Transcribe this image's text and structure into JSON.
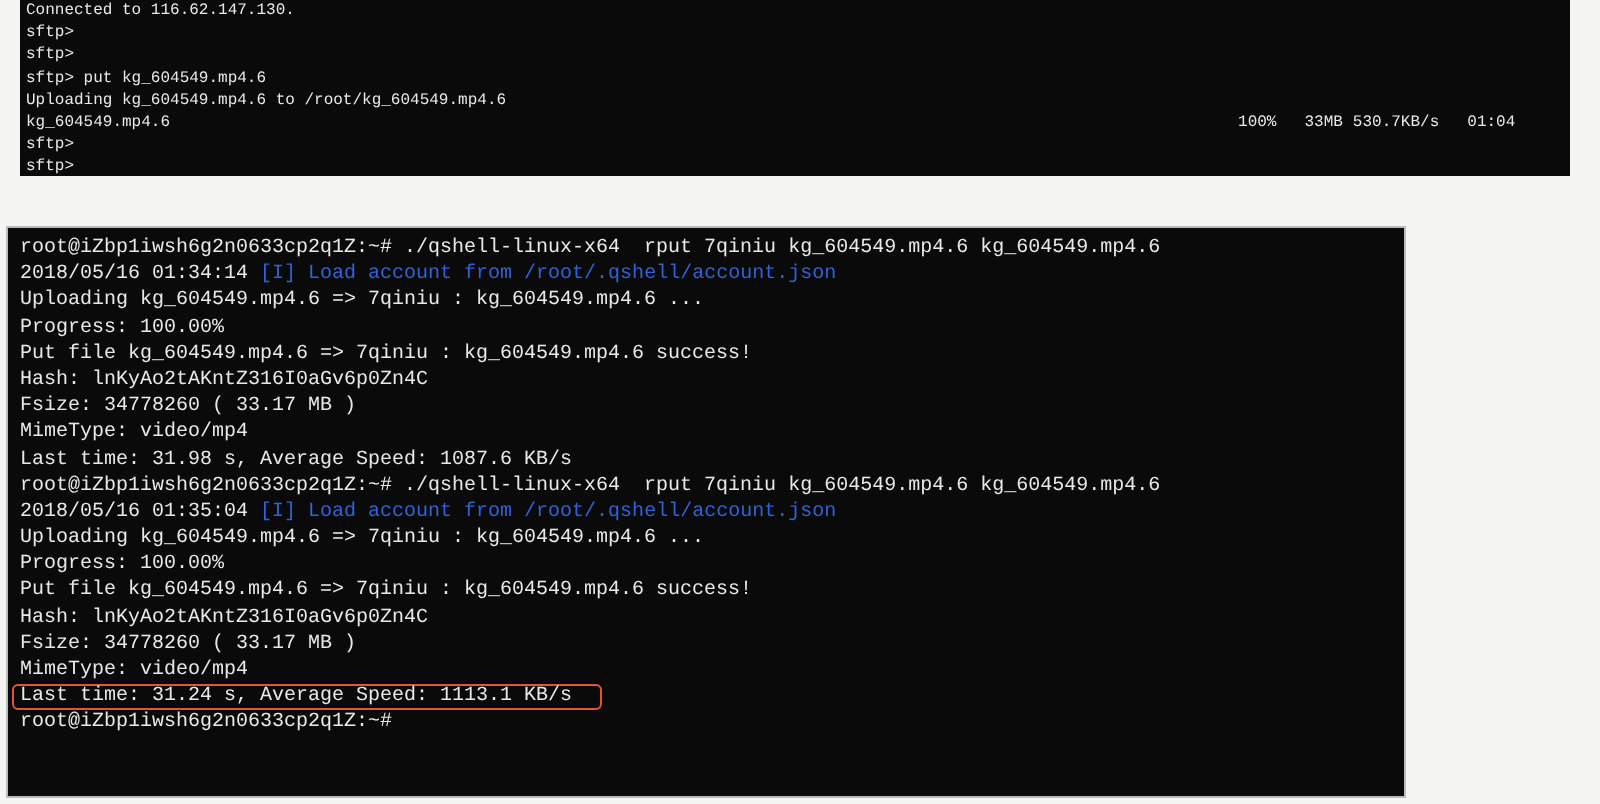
{
  "sftp_terminal": {
    "lines": [
      {
        "kind": "plain",
        "text": "Connected to 116.62.147.130."
      },
      {
        "kind": "plain",
        "text": "sftp>"
      },
      {
        "kind": "plain",
        "text": "sftp>"
      },
      {
        "kind": "plain",
        "text": "sftp> put kg_604549.mp4.6"
      },
      {
        "kind": "plain",
        "text": "Uploading kg_604549.mp4.6 to /root/kg_604549.mp4.6"
      },
      {
        "kind": "progress",
        "file": "kg_604549.mp4.6",
        "percent": "100%",
        "transferred": "33MB",
        "speed": "530.7KB/s",
        "eta": "01:04"
      },
      {
        "kind": "plain",
        "text": "sftp>"
      },
      {
        "kind": "plain",
        "text": "sftp>"
      }
    ]
  },
  "qshell_terminal": {
    "lines": [
      {
        "highlighted": false,
        "segments": [
          {
            "kind": "plain",
            "text": "root@iZbp1iwsh6g2n0633cp2q1Z:~# ./qshell-linux-x64  rput 7qiniu kg_604549.mp4.6 kg_604549.mp4.6"
          }
        ]
      },
      {
        "highlighted": false,
        "segments": [
          {
            "kind": "plain",
            "text": "2018/05/16 01:34:14 "
          },
          {
            "kind": "info",
            "text": "[I] Load account from /root/.qshell/account.json"
          }
        ]
      },
      {
        "highlighted": false,
        "segments": [
          {
            "kind": "plain",
            "text": "Uploading kg_604549.mp4.6 => 7qiniu : kg_604549.mp4.6 ..."
          }
        ]
      },
      {
        "highlighted": false,
        "segments": [
          {
            "kind": "plain",
            "text": "Progress: 100.00%"
          }
        ]
      },
      {
        "highlighted": false,
        "segments": [
          {
            "kind": "plain",
            "text": "Put file kg_604549.mp4.6 => 7qiniu : kg_604549.mp4.6 success!"
          }
        ]
      },
      {
        "highlighted": false,
        "segments": [
          {
            "kind": "plain",
            "text": "Hash: lnKyAo2tAKntZ316I0aGv6p0Zn4C"
          }
        ]
      },
      {
        "highlighted": false,
        "segments": [
          {
            "kind": "plain",
            "text": "Fsize: 34778260 ( 33.17 MB )"
          }
        ]
      },
      {
        "highlighted": false,
        "segments": [
          {
            "kind": "plain",
            "text": "MimeType: video/mp4"
          }
        ]
      },
      {
        "highlighted": false,
        "segments": [
          {
            "kind": "plain",
            "text": "Last time: 31.98 s, Average Speed: 1087.6 KB/s"
          }
        ]
      },
      {
        "highlighted": false,
        "segments": [
          {
            "kind": "plain",
            "text": "root@iZbp1iwsh6g2n0633cp2q1Z:~# ./qshell-linux-x64  rput 7qiniu kg_604549.mp4.6 kg_604549.mp4.6"
          }
        ]
      },
      {
        "highlighted": false,
        "segments": [
          {
            "kind": "plain",
            "text": "2018/05/16 01:35:04 "
          },
          {
            "kind": "info",
            "text": "[I] Load account from /root/.qshell/account.json"
          }
        ]
      },
      {
        "highlighted": false,
        "segments": [
          {
            "kind": "plain",
            "text": "Uploading kg_604549.mp4.6 => 7qiniu : kg_604549.mp4.6 ..."
          }
        ]
      },
      {
        "highlighted": false,
        "segments": [
          {
            "kind": "plain",
            "text": "Progress: 100.00%"
          }
        ]
      },
      {
        "highlighted": false,
        "segments": [
          {
            "kind": "plain",
            "text": "Put file kg_604549.mp4.6 => 7qiniu : kg_604549.mp4.6 success!"
          }
        ]
      },
      {
        "highlighted": false,
        "segments": [
          {
            "kind": "plain",
            "text": "Hash: lnKyAo2tAKntZ316I0aGv6p0Zn4C"
          }
        ]
      },
      {
        "highlighted": false,
        "segments": [
          {
            "kind": "plain",
            "text": "Fsize: 34778260 ( 33.17 MB )"
          }
        ]
      },
      {
        "highlighted": false,
        "segments": [
          {
            "kind": "plain",
            "text": "MimeType: video/mp4"
          }
        ]
      },
      {
        "highlighted": true,
        "segments": [
          {
            "kind": "plain",
            "text": "Last time: 31.24 s, Average Speed: 1113.1 KB/s"
          }
        ]
      },
      {
        "highlighted": false,
        "segments": [
          {
            "kind": "plain",
            "text": "root@iZbp1iwsh6g2n0633cp2q1Z:~#"
          }
        ]
      }
    ]
  }
}
